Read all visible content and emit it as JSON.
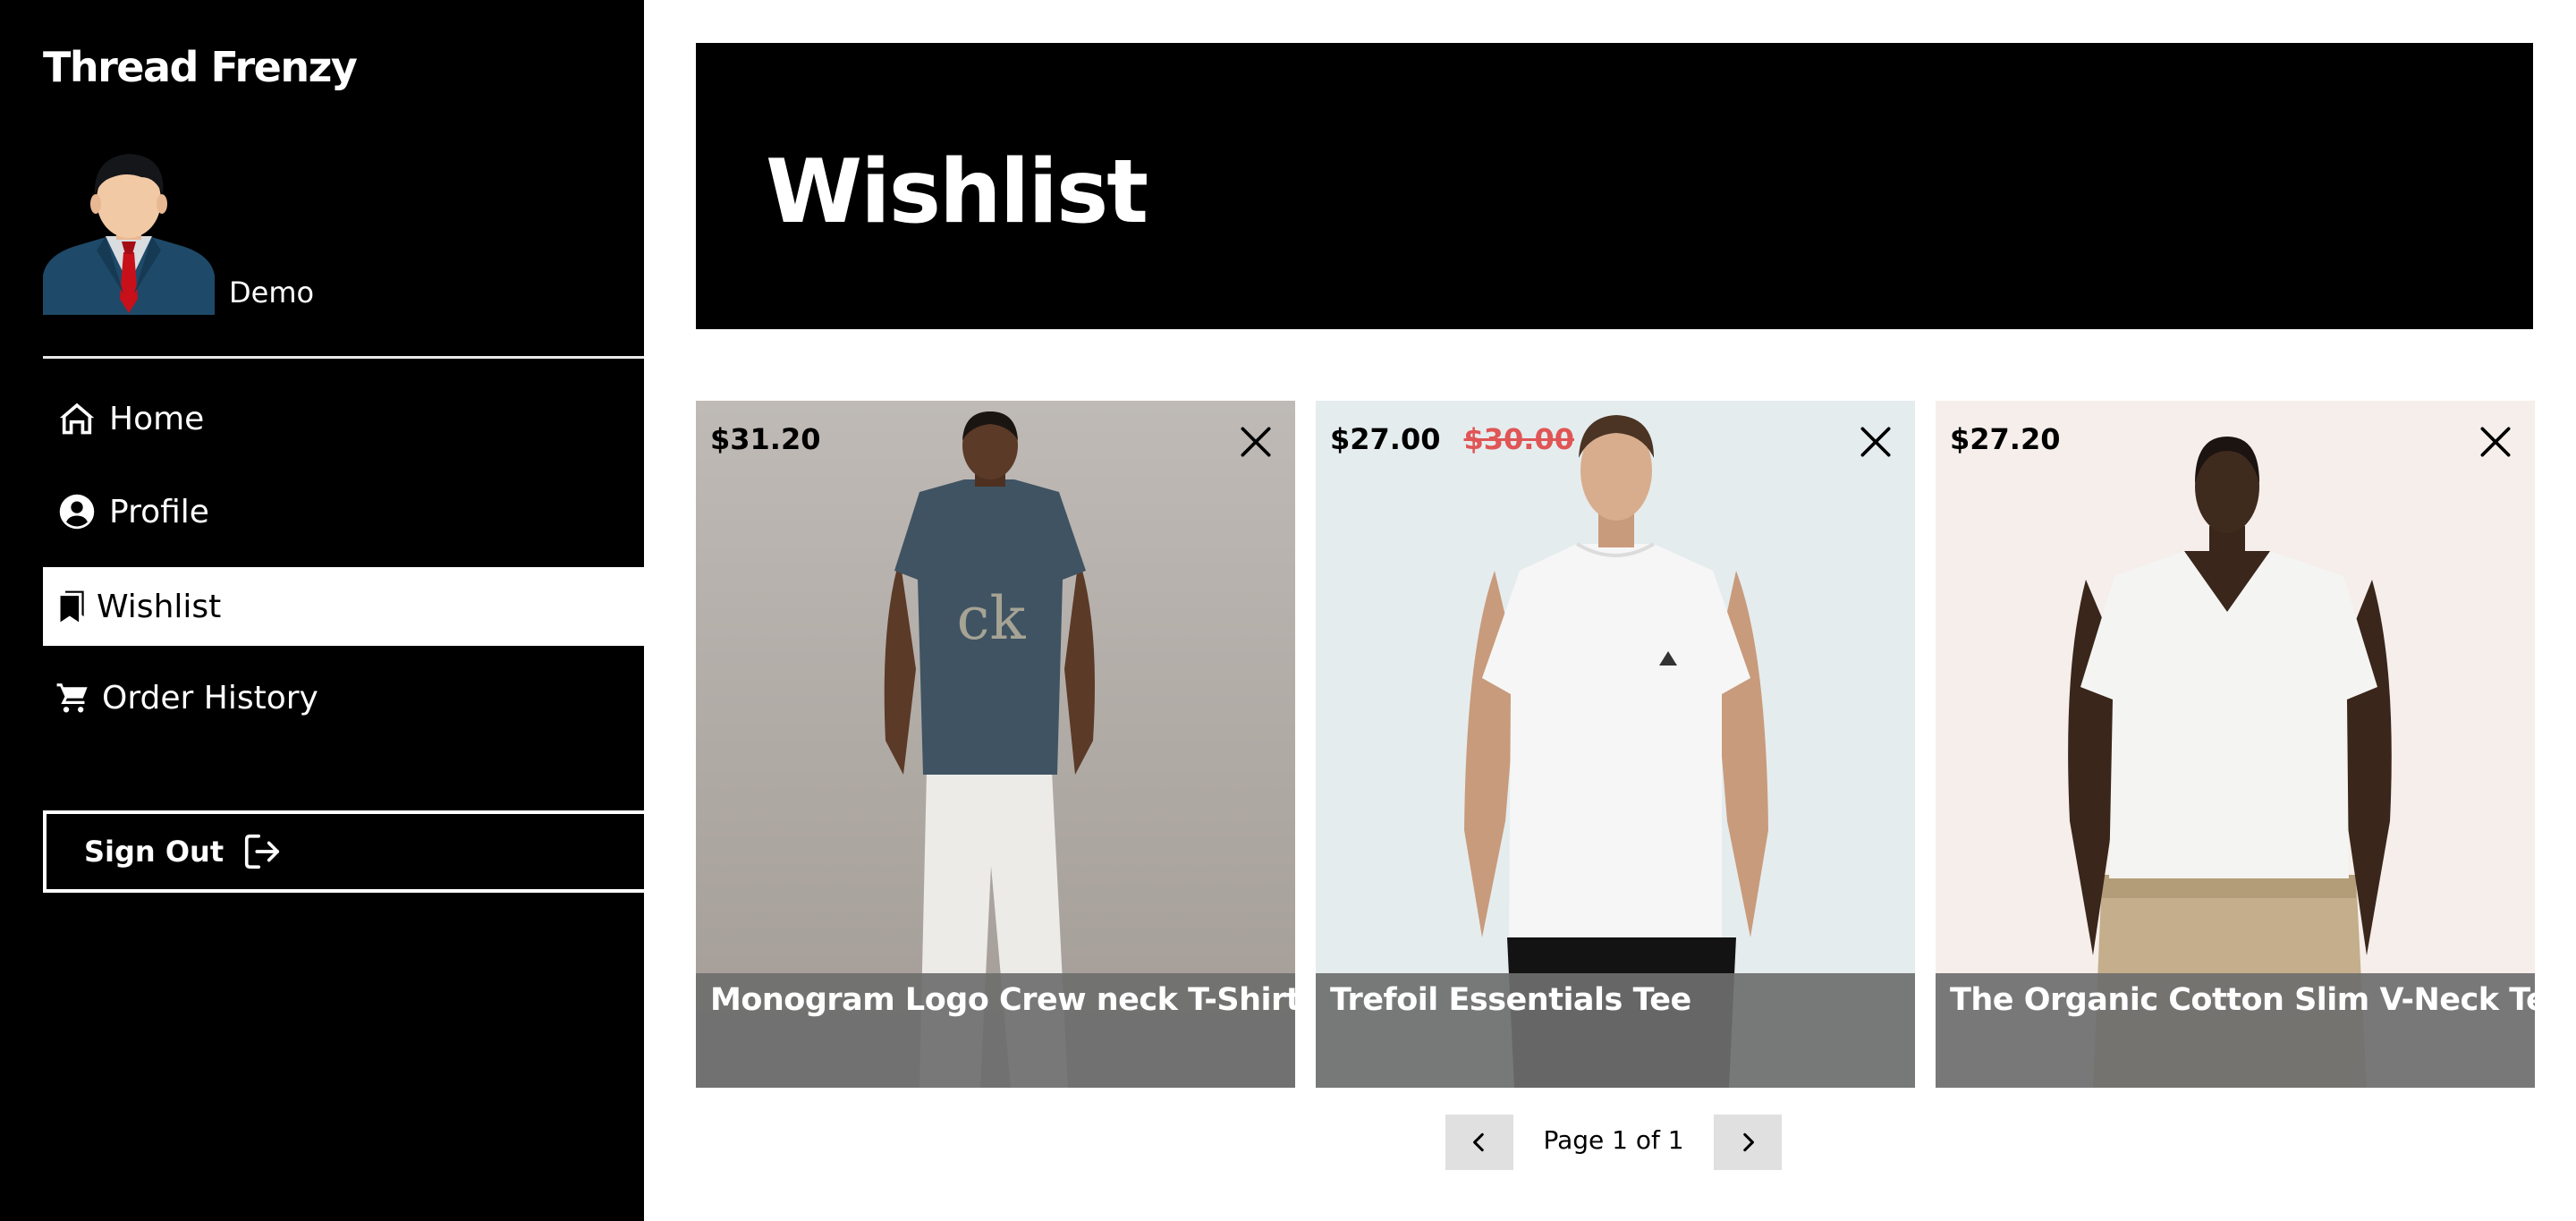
{
  "sidebar": {
    "brand": "Thread Frenzy",
    "username": "Demo",
    "nav": [
      {
        "label": "Home",
        "icon": "home-icon",
        "active": false
      },
      {
        "label": "Profile",
        "icon": "user-circle-icon",
        "active": false
      },
      {
        "label": "Wishlist",
        "icon": "bookmarks-icon",
        "active": true
      },
      {
        "label": "Order History",
        "icon": "cart-icon",
        "active": false
      }
    ],
    "sign_out": {
      "label": "Sign Out",
      "icon": "sign-out-icon"
    }
  },
  "header": {
    "title": "Wishlist"
  },
  "wishlist": {
    "items": [
      {
        "name": "Monogram Logo Crew neck T-Shirt",
        "price": "$31.20",
        "original_price": ""
      },
      {
        "name": "Trefoil Essentials Tee",
        "price": "$27.00",
        "original_price": "$30.00"
      },
      {
        "name": "The Organic Cotton Slim V-Neck Tee",
        "price": "$27.20",
        "original_price": ""
      }
    ]
  },
  "pagination": {
    "text": "Page 1 of 1"
  },
  "colors": {
    "sidebar_bg": "#000000",
    "accent": "#000000",
    "sale_price": "#e05555",
    "caption_overlay": "#6e6e6e",
    "pager_button": "#e0e0e0"
  }
}
